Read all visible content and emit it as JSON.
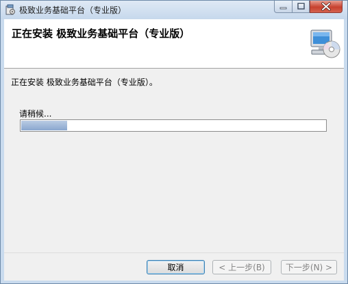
{
  "window": {
    "title": "极致业务基础平台（专业版）",
    "controls": {
      "minimize_icon": "minimize-icon",
      "maximize_icon": "maximize-icon",
      "close_icon": "close-icon"
    }
  },
  "header": {
    "title": "正在安装 极致业务基础平台（专业版）",
    "graphic_icon": "computer-cd-icon"
  },
  "content": {
    "status_message": "正在安装 极致业务基础平台（专业版）。",
    "wait_label": "请稍候...",
    "progress": {
      "fraction": 0.03
    }
  },
  "footer": {
    "cancel_label": "取消",
    "back_label": "< 上一步(B)",
    "next_label": "下一步(N) >"
  },
  "colors": {
    "progress_fill": "#8aa7cf",
    "close_button": "#c7412f",
    "disabled_text": "#838383"
  }
}
